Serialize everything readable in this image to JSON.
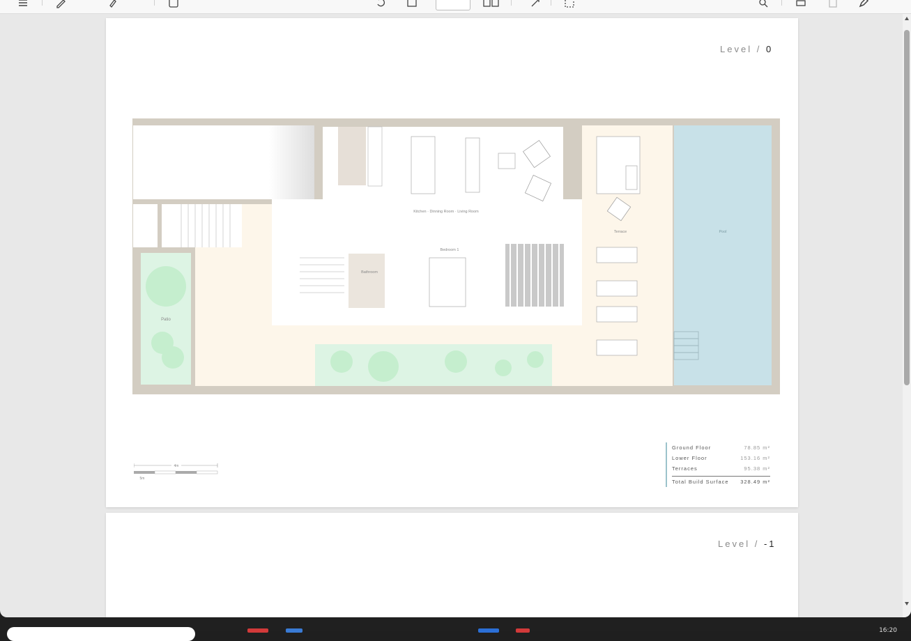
{
  "toolbar": {
    "icons": [
      "list-icon",
      "draw-icon",
      "highlight-icon",
      "text-box-icon",
      "rotate-icon",
      "fit-page-icon",
      "page-number-box",
      "two-page-icon",
      "expand-icon",
      "select-icon",
      "search-icon",
      "print-icon",
      "save-icon",
      "edit-icon"
    ]
  },
  "pages": [
    {
      "level_label": "Level",
      "level_sep": "/",
      "level_num": "0",
      "rooms": {
        "patio": "Patio",
        "kitchen": "Kitchen · Dinning Room · Living Room",
        "bedroom": "Bedroom 1",
        "bathroom": "Bathroom",
        "terrace": "Terrace",
        "pool": "Pool"
      },
      "scale": {
        "top": "4m",
        "bottom": "5m"
      },
      "legend": [
        {
          "label": "Ground Floor",
          "value": "78.85 m²"
        },
        {
          "label": "Lower Floor",
          "value": "153.16 m²"
        },
        {
          "label": "Terraces",
          "value": "95.38 m²"
        }
      ],
      "legend_total": {
        "label": "Total Build Surface",
        "value": "328.49 m²"
      }
    },
    {
      "level_label": "Level",
      "level_sep": "/",
      "level_num": "-1"
    }
  ],
  "colors": {
    "wall": "#d3cdc2",
    "terrace": "#fdf6ea",
    "garden": "#ddf4e4",
    "tree": "#bfecc9",
    "pool": "#c8e1e8",
    "legend_accent": "#9cc3cc"
  },
  "taskbar": {
    "clock": "16:20"
  }
}
